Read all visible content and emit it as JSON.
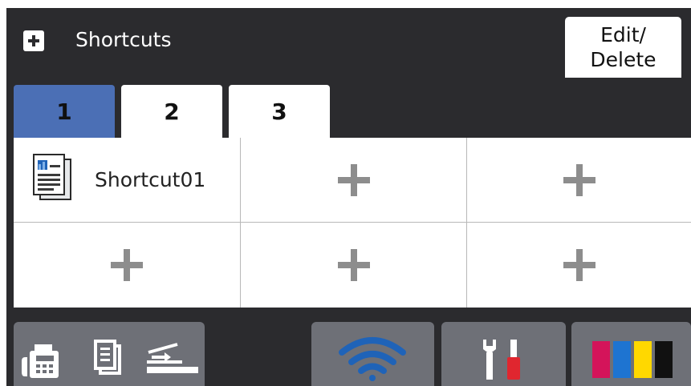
{
  "header": {
    "title": "Shortcuts",
    "edit_button_line1": "Edit/",
    "edit_button_line2": "Delete"
  },
  "tabs": [
    {
      "label": "1",
      "active": true
    },
    {
      "label": "2",
      "active": false
    },
    {
      "label": "3",
      "active": false
    }
  ],
  "shortcuts": {
    "cells": [
      {
        "type": "shortcut",
        "label": "Shortcut01",
        "icon": "copy-document-icon"
      },
      {
        "type": "empty",
        "icon": "plus-icon"
      },
      {
        "type": "empty",
        "icon": "plus-icon"
      },
      {
        "type": "empty",
        "icon": "plus-icon"
      },
      {
        "type": "empty",
        "icon": "plus-icon"
      },
      {
        "type": "empty",
        "icon": "plus-icon"
      }
    ]
  },
  "bottom_bar": {
    "buttons": [
      {
        "name": "function-modes",
        "icons": [
          "fax-icon",
          "copy-icon",
          "scan-icon"
        ]
      },
      {
        "name": "wifi",
        "icons": [
          "wifi-icon"
        ]
      },
      {
        "name": "settings",
        "icons": [
          "tools-icon"
        ]
      },
      {
        "name": "ink",
        "icons": [
          "ink-levels-icon"
        ]
      }
    ]
  },
  "colors": {
    "screen_bg": "#2b2b2e",
    "active_tab": "#4b6fb5",
    "bottom_button": "#6e7077",
    "wifi": "#1f63b8",
    "ink_magenta": "#d4145a",
    "ink_cyan": "#1e74d1",
    "ink_yellow": "#ffd800",
    "ink_black": "#111111"
  }
}
